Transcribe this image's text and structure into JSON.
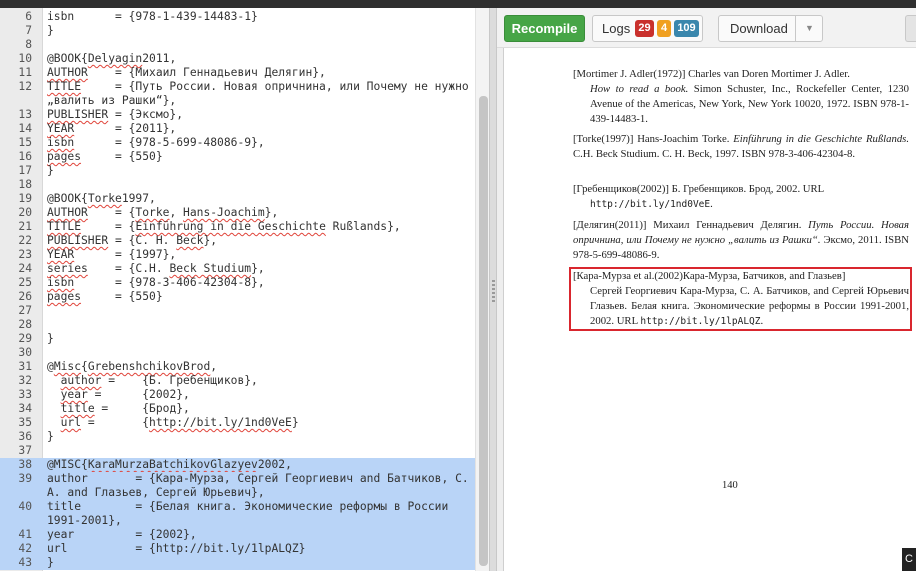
{
  "editor": {
    "lines": [
      {
        "n": "6",
        "parts": [
          {
            "t": "isbn      = {978-1-439-14483-1}"
          }
        ]
      },
      {
        "n": "7",
        "parts": [
          {
            "t": "}"
          }
        ]
      },
      {
        "n": "8",
        "parts": [
          {
            "t": ""
          }
        ]
      },
      {
        "n": "10",
        "parts": [
          {
            "t": "@BOOK{"
          },
          {
            "t": "Delyagin",
            "sp": true
          },
          {
            "t": "2011,"
          }
        ]
      },
      {
        "n": "11",
        "parts": [
          {
            "t": "AUTHOR",
            "sp": true
          },
          {
            "t": "    = {Михаил Геннадьевич Делягин},"
          }
        ]
      },
      {
        "n": "12",
        "parts": [
          {
            "t": "TITLE",
            "sp": true
          },
          {
            "t": "     = {Путь России. Новая опричнина, или Почему не нужно „валить из Рашки“},"
          }
        ]
      },
      {
        "n": "13",
        "parts": [
          {
            "t": "PUBLISHER",
            "sp": true
          },
          {
            "t": " = {Эксмо},"
          }
        ]
      },
      {
        "n": "14",
        "parts": [
          {
            "t": "YEAR",
            "sp": true
          },
          {
            "t": "      = {2011},"
          }
        ]
      },
      {
        "n": "15",
        "parts": [
          {
            "t": "isbn",
            "sp": true
          },
          {
            "t": "      = {978-5-699-48086-9},"
          }
        ]
      },
      {
        "n": "16",
        "parts": [
          {
            "t": "pages",
            "sp": true
          },
          {
            "t": "     = {550}"
          }
        ]
      },
      {
        "n": "17",
        "parts": [
          {
            "t": "}"
          }
        ]
      },
      {
        "n": "18",
        "parts": [
          {
            "t": ""
          }
        ]
      },
      {
        "n": "19",
        "parts": [
          {
            "t": "@BOOK{"
          },
          {
            "t": "Torke",
            "sp": true
          },
          {
            "t": "1997,"
          }
        ]
      },
      {
        "n": "20",
        "parts": [
          {
            "t": "AUTHOR",
            "sp": true
          },
          {
            "t": "    = {"
          },
          {
            "t": "Torke",
            "sp": true
          },
          {
            "t": ", "
          },
          {
            "t": "Hans-Joachim",
            "sp": true
          },
          {
            "t": "},"
          }
        ]
      },
      {
        "n": "21",
        "parts": [
          {
            "t": "TITLE",
            "sp": true
          },
          {
            "t": "     = {"
          },
          {
            "t": "Einführung in die Geschichte",
            "sp": true
          },
          {
            "t": " Rußlands},"
          }
        ]
      },
      {
        "n": "22",
        "parts": [
          {
            "t": "PUBLISHER",
            "sp": true
          },
          {
            "t": " = {С. H. "
          },
          {
            "t": "Beck",
            "sp": true
          },
          {
            "t": "},"
          }
        ]
      },
      {
        "n": "23",
        "parts": [
          {
            "t": "YEAR",
            "sp": true
          },
          {
            "t": "      = {1997},"
          }
        ]
      },
      {
        "n": "24",
        "parts": [
          {
            "t": "series",
            "sp": true
          },
          {
            "t": "    = {C.H. "
          },
          {
            "t": "Beck Studium",
            "sp": true
          },
          {
            "t": "},"
          }
        ]
      },
      {
        "n": "25",
        "parts": [
          {
            "t": "isbn",
            "sp": true
          },
          {
            "t": "      = {978-3-406-42304-8},"
          }
        ]
      },
      {
        "n": "26",
        "parts": [
          {
            "t": "pages",
            "sp": true
          },
          {
            "t": "     = {550}"
          }
        ]
      },
      {
        "n": "27",
        "parts": [
          {
            "t": ""
          }
        ]
      },
      {
        "n": "28",
        "parts": [
          {
            "t": ""
          }
        ]
      },
      {
        "n": "29",
        "parts": [
          {
            "t": "}"
          }
        ]
      },
      {
        "n": "30",
        "parts": [
          {
            "t": ""
          }
        ]
      },
      {
        "n": "31",
        "parts": [
          {
            "t": "@"
          },
          {
            "t": "Misc",
            "sp": true
          },
          {
            "t": "{"
          },
          {
            "t": "GrebenshchikovBrod",
            "sp": true
          },
          {
            "t": ","
          }
        ]
      },
      {
        "n": "32",
        "parts": [
          {
            "t": "  "
          },
          {
            "t": "author",
            "sp": true
          },
          {
            "t": " =    {Б. Гребенщиков},"
          }
        ]
      },
      {
        "n": "33",
        "parts": [
          {
            "t": "  "
          },
          {
            "t": "year",
            "sp": true
          },
          {
            "t": " =      {2002},"
          }
        ]
      },
      {
        "n": "34",
        "parts": [
          {
            "t": "  "
          },
          {
            "t": "title",
            "sp": true
          },
          {
            "t": " =     {Брод},"
          }
        ]
      },
      {
        "n": "35",
        "parts": [
          {
            "t": "  "
          },
          {
            "t": "url",
            "sp": true
          },
          {
            "t": " =       {"
          },
          {
            "t": "http://bit.ly/1nd0VeE",
            "sp": true
          },
          {
            "t": "}"
          }
        ]
      },
      {
        "n": "36",
        "parts": [
          {
            "t": "}"
          }
        ]
      },
      {
        "n": "37",
        "parts": [
          {
            "t": ""
          }
        ]
      },
      {
        "n": "38",
        "hl": true,
        "parts": [
          {
            "t": "@MISC{"
          },
          {
            "t": "KaraMurzaBatchikovGlazyev",
            "sp": true
          },
          {
            "t": "2002,"
          }
        ]
      },
      {
        "n": "39",
        "hl": true,
        "parts": [
          {
            "t": "author       = {Кара-Мурза, Сергей Георгиевич and Батчиков, С. А. and Глазьев, Сергей Юрьевич},"
          }
        ]
      },
      {
        "n": "40",
        "hl": true,
        "parts": [
          {
            "t": "title        = {Белая книга. Экономические реформы в России 1991-2001},"
          }
        ]
      },
      {
        "n": "41",
        "hl": true,
        "parts": [
          {
            "t": "year         = {2002},"
          }
        ]
      },
      {
        "n": "42",
        "hl": true,
        "parts": [
          {
            "t": "url          = {http://bit.ly/1lpALQZ}"
          }
        ]
      },
      {
        "n": "43",
        "hl": true,
        "parts": [
          {
            "t": "}"
          }
        ]
      }
    ]
  },
  "toolbar": {
    "recompile_label": "Recompile",
    "logs_label": "Logs",
    "logs_errors": "29",
    "logs_warnings": "4",
    "logs_info": "109",
    "download_label": "Download"
  },
  "preview": {
    "references": [
      {
        "key": "[Mortimer J. Adler(1972)]",
        "text": " Charles van Doren Mortimer J. Adler.",
        "cont": [
          {
            "i": "How to read a book."
          },
          {
            "t": " Simon Schuster, Inc., Rockefeller Center, 1230 Avenue of the Americas, New York, New York 10020, 1972. ISBN 978-1-439-14483-1."
          }
        ]
      },
      {
        "key": "[Torke(1997)]",
        "text": " Hans-Joachim Torke. ",
        "inline": [
          {
            "i": "Einführung in die Geschichte Rußlands."
          },
          {
            "t": " C.H. Beck Studium. C. H. Beck, 1997. ISBN 978-3-406-42304-8."
          }
        ]
      },
      {
        "key": "[Гребенщиков(2002)]",
        "text": " Б. Гребенщиков. Брод, 2002. URL",
        "cont": [
          {
            "tt": "http://bit.ly/1nd0VeE"
          },
          {
            "t": "."
          }
        ]
      },
      {
        "key": "[Делягин(2011)]",
        "text": " Михаил Геннадьевич Делягин. ",
        "inline": [
          {
            "i": "Путь России. Новая опричнина, или Почему не нужно „валить из Рашки“."
          },
          {
            "t": " Эксмо, 2011. ISBN 978-5-699-48086-9."
          }
        ]
      },
      {
        "key": "[Кара-Мурза et al.(2002)",
        "text": "Кара-Мурза, Батчиков, and Глазьев]",
        "cont": [
          {
            "t": "Сергей Георгиевич Кара-Мурза, С. А. Батчиков, and Сергей Юрьевич Глазьев. Белая книга. Экономические реформы в России 1991-2001, 2002. URL "
          },
          {
            "tt": "http://bit.ly/1lpALQZ"
          },
          {
            "t": "."
          }
        ]
      }
    ],
    "page_number": "140"
  },
  "corner_label": "C"
}
